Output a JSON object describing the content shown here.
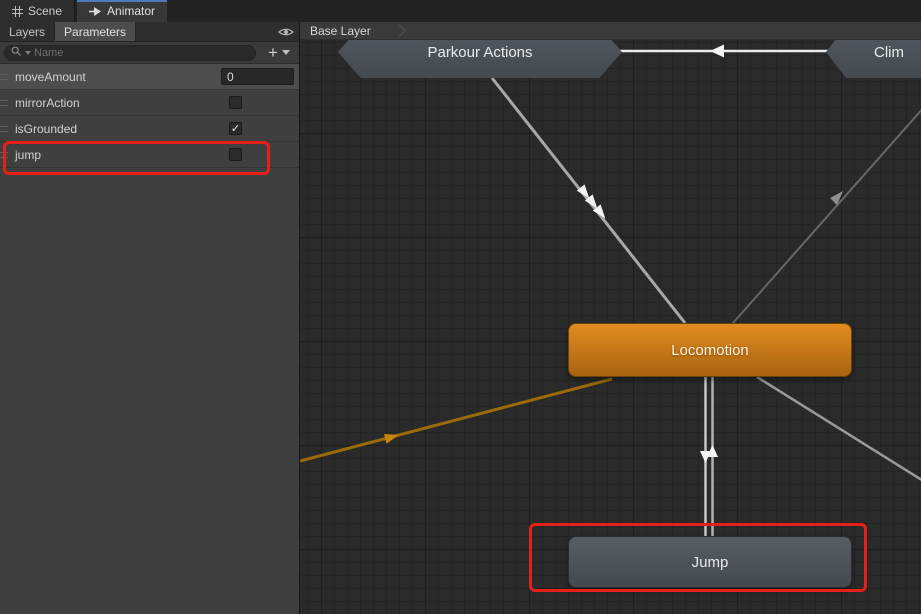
{
  "topbar": {
    "tabs": [
      {
        "label": "Scene"
      },
      {
        "label": "Animator"
      }
    ]
  },
  "left_panel": {
    "tabs": {
      "layers": "Layers",
      "parameters": "Parameters"
    },
    "search": {
      "placeholder": "Name",
      "add_label": "+"
    },
    "check_glyph": "✓",
    "parameters": [
      {
        "name": "moveAmount",
        "type": "float",
        "value": "0"
      },
      {
        "name": "mirrorAction",
        "type": "bool",
        "checked": false
      },
      {
        "name": "isGrounded",
        "type": "bool",
        "checked": true
      },
      {
        "name": "jump",
        "type": "bool",
        "checked": false
      }
    ]
  },
  "graph": {
    "breadcrumb": "Base Layer",
    "nodes": {
      "parkour": {
        "label": "Parkour Actions",
        "kind": "sub-state-machine"
      },
      "climbing": {
        "label": "Clim",
        "kind": "sub-state-machine",
        "clipped_by_viewport": true
      },
      "locomotion": {
        "label": "Locomotion",
        "kind": "default-state"
      },
      "jump": {
        "label": "Jump",
        "kind": "state",
        "annotated": true
      }
    }
  },
  "colors": {
    "default_state_orange": "#d8821a",
    "entry_transition_orange": "#9a6b08",
    "annotation_red": "#e32119",
    "active_tab_blue": "#4c7bbd"
  }
}
